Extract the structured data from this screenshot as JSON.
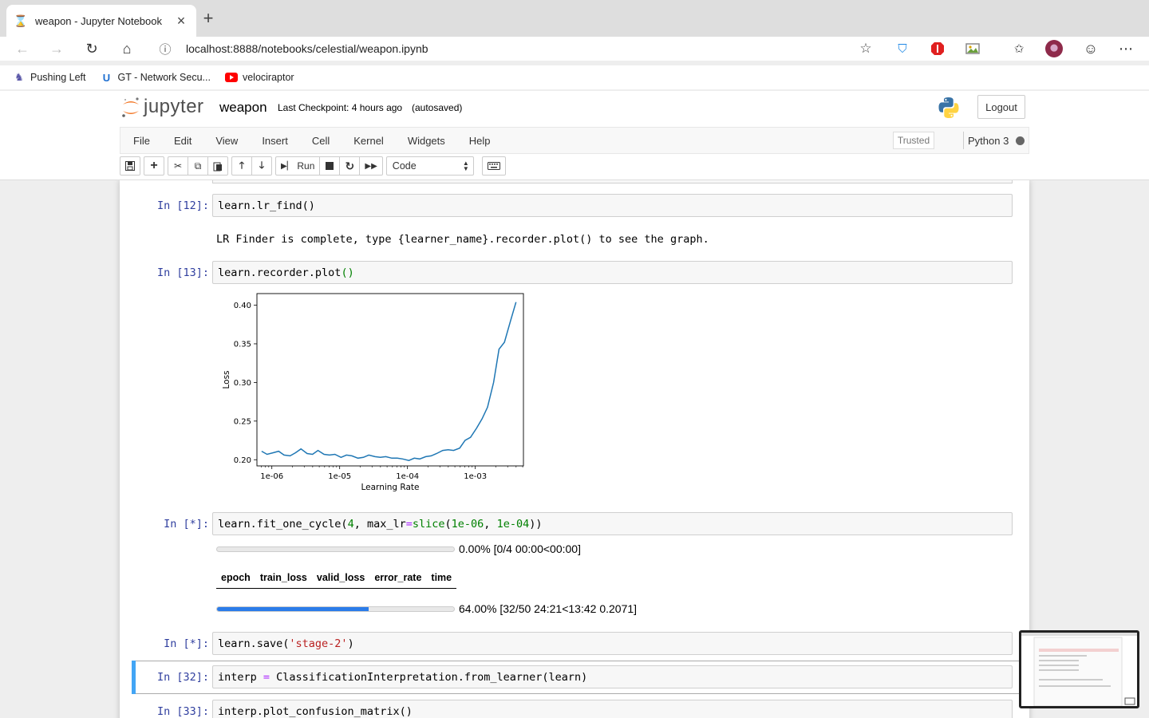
{
  "browser": {
    "tab_title": "weapon - Jupyter Notebook",
    "url": "localhost:8888/notebooks/celestial/weapon.ipynb",
    "bookmarks": [
      "Pushing Left",
      "GT - Network Secu...",
      "velociraptor"
    ]
  },
  "jupyter": {
    "logo_text": "jupyter",
    "notebook_name": "weapon",
    "checkpoint": "Last Checkpoint: 4 hours ago",
    "autosave": "(autosaved)",
    "logout": "Logout",
    "menu": [
      "File",
      "Edit",
      "View",
      "Insert",
      "Cell",
      "Kernel",
      "Widgets",
      "Help"
    ],
    "trusted": "Trusted",
    "kernel_name": "Python 3",
    "run_label": "Run",
    "cell_type": "Code"
  },
  "cells": {
    "c12": {
      "prompt": "In [12]:",
      "code": "learn.lr_find()",
      "output": "LR Finder is complete, type {learner_name}.recorder.plot() to see the graph."
    },
    "c13": {
      "prompt": "In [13]:",
      "code_main": "learn.recorder.plot",
      "code_parens": "()"
    },
    "fit": {
      "prompt": "In [*]:",
      "code_a": "learn.fit_one_cycle(",
      "arg1": "4",
      "code_b": ", max_lr",
      "eq": "=",
      "fn": "slice",
      "code_c": "(",
      "arg2": "1e-06",
      "code_d": ", ",
      "arg3": "1e-04",
      "code_e": "))",
      "progress1_text": "0.00% [0/4 00:00<00:00]",
      "progress1_value": 0.0,
      "table_headers": [
        "epoch",
        "train_loss",
        "valid_loss",
        "error_rate",
        "time"
      ],
      "progress2_text": "64.00% [32/50 24:21<13:42 0.2071]",
      "progress2_value": 0.64
    },
    "save": {
      "prompt": "In [*]:",
      "code_a": "learn.save(",
      "str": "'stage-2'",
      "code_b": ")"
    },
    "c32": {
      "prompt": "In [32]:",
      "code_a": "interp ",
      "eq": "=",
      "code_b": " ClassificationInterpretation.from_learner(learn)"
    },
    "c33": {
      "prompt": "In [33]:",
      "code": "interp.plot_confusion_matrix()"
    }
  },
  "chart_data": {
    "type": "line",
    "xlabel": "Learning Rate",
    "ylabel": "Loss",
    "x_scale": "log",
    "x_ticks": [
      "1e-06",
      "1e-05",
      "1e-04",
      "1e-03"
    ],
    "y_ticks": [
      "0.20",
      "0.25",
      "0.30",
      "0.35",
      "0.40"
    ],
    "ylim": [
      0.192,
      0.415
    ],
    "xlim_log10": [
      -6.22,
      -2.29
    ],
    "color": "#1f77b4",
    "series": [
      {
        "x_log10": [
          -6.15,
          -6.07,
          -5.98,
          -5.9,
          -5.82,
          -5.73,
          -5.65,
          -5.57,
          -5.48,
          -5.4,
          -5.32,
          -5.23,
          -5.15,
          -5.07,
          -4.98,
          -4.9,
          -4.82,
          -4.73,
          -4.65,
          -4.57,
          -4.48,
          -4.4,
          -4.32,
          -4.23,
          -4.15,
          -4.07,
          -3.98,
          -3.9,
          -3.82,
          -3.73,
          -3.65,
          -3.57,
          -3.48,
          -3.4,
          -3.32,
          -3.23,
          -3.15,
          -3.07,
          -2.98,
          -2.9,
          -2.82,
          -2.73,
          -2.65,
          -2.57,
          -2.48,
          -2.4
        ],
        "y": [
          0.211,
          0.207,
          0.209,
          0.211,
          0.206,
          0.205,
          0.209,
          0.214,
          0.208,
          0.207,
          0.212,
          0.207,
          0.206,
          0.207,
          0.203,
          0.206,
          0.205,
          0.202,
          0.203,
          0.206,
          0.204,
          0.203,
          0.204,
          0.202,
          0.202,
          0.201,
          0.199,
          0.202,
          0.201,
          0.204,
          0.205,
          0.208,
          0.212,
          0.213,
          0.212,
          0.215,
          0.225,
          0.229,
          0.241,
          0.253,
          0.268,
          0.3,
          0.343,
          0.352,
          0.38,
          0.404
        ]
      }
    ]
  }
}
